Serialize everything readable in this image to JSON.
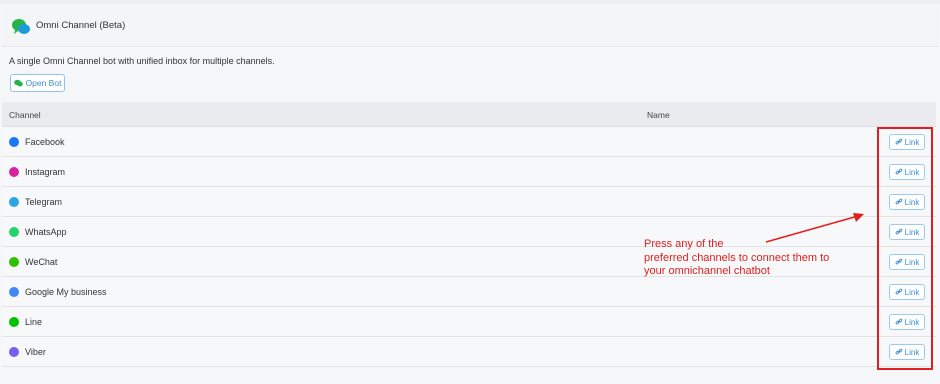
{
  "header": {
    "title": "Omni Channel (Beta)",
    "logo_icon": "omni-chat-bubbles-icon"
  },
  "description": "A single Omni Channel bot with unified inbox for multiple channels.",
  "open_bot_label": "Open Bot",
  "table": {
    "headers": {
      "channel": "Channel",
      "name": "Name"
    },
    "link_label": "Link",
    "rows": [
      {
        "channel": "Facebook",
        "icon": "messenger-icon",
        "color": "#1877f2"
      },
      {
        "channel": "Instagram",
        "icon": "instagram-icon",
        "color": "#d6249f"
      },
      {
        "channel": "Telegram",
        "icon": "telegram-icon",
        "color": "#2ca5e0"
      },
      {
        "channel": "WhatsApp",
        "icon": "whatsapp-icon",
        "color": "#25d366"
      },
      {
        "channel": "WeChat",
        "icon": "wechat-icon",
        "color": "#2dc100"
      },
      {
        "channel": "Google My business",
        "icon": "google-icon",
        "color": "#4285f4"
      },
      {
        "channel": "Line",
        "icon": "line-icon",
        "color": "#00c300"
      },
      {
        "channel": "Viber",
        "icon": "viber-icon",
        "color": "#7360f2"
      }
    ]
  },
  "annotation": {
    "lines": [
      "Press any of the",
      "preferred channels to connect them to",
      "your omnichannel chatbot"
    ],
    "color": "#e02020"
  }
}
